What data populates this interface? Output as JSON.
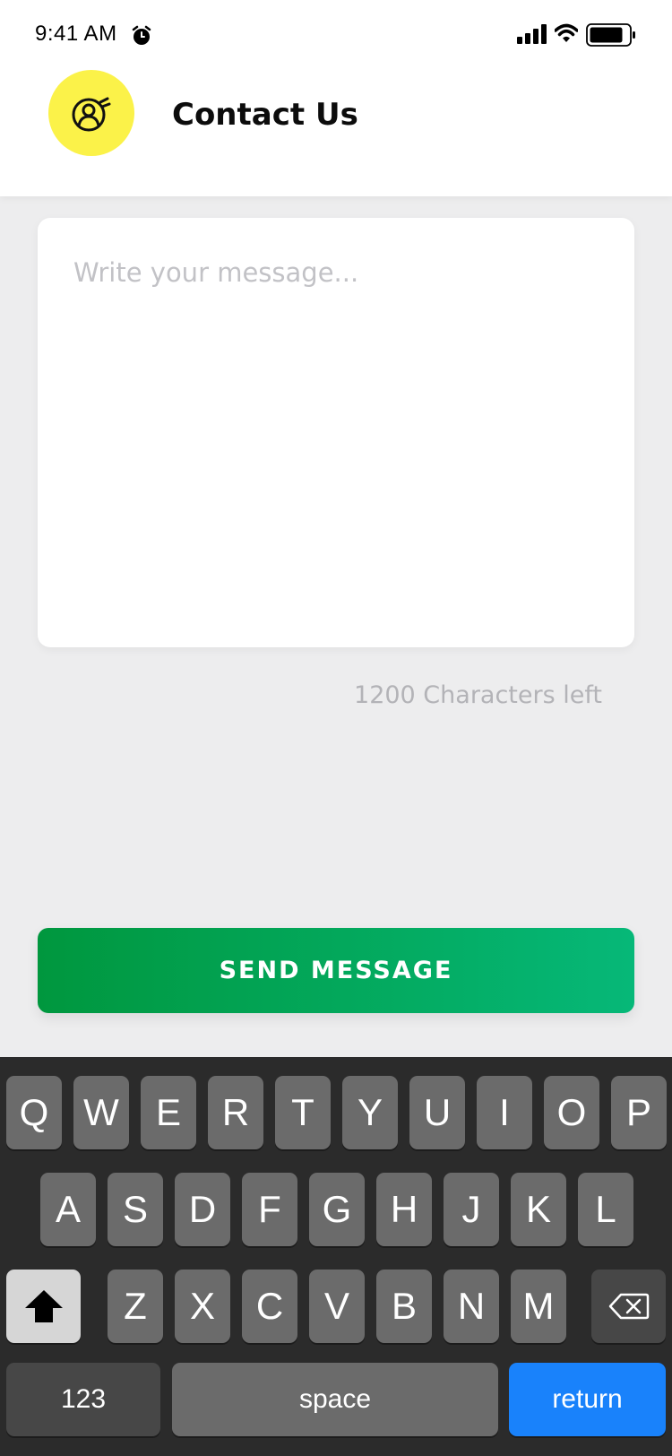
{
  "status_bar": {
    "time": "9:41 AM",
    "icons": [
      "alarm-icon",
      "signal-icon",
      "wifi-icon",
      "battery-icon"
    ]
  },
  "header": {
    "title": "Contact Us",
    "avatar_icon": "contact-person-icon",
    "avatar_color": "#fbf249"
  },
  "message": {
    "placeholder": "Write your message...",
    "value": "",
    "chars_left": "1200 Characters left"
  },
  "send_button": {
    "label": "SEND MESSAGE",
    "gradient": [
      "#00973e",
      "#06b878"
    ]
  },
  "keyboard": {
    "row1": [
      "Q",
      "W",
      "E",
      "R",
      "T",
      "Y",
      "U",
      "I",
      "O",
      "P"
    ],
    "row2": [
      "A",
      "S",
      "D",
      "F",
      "G",
      "H",
      "J",
      "K",
      "L"
    ],
    "row3": [
      "Z",
      "X",
      "C",
      "V",
      "B",
      "N",
      "M"
    ],
    "shift_icon": "shift-icon",
    "delete_icon": "backspace-icon",
    "numbers_label": "123",
    "space_label": "space",
    "return_label": "return",
    "return_color": "#1982fb"
  }
}
